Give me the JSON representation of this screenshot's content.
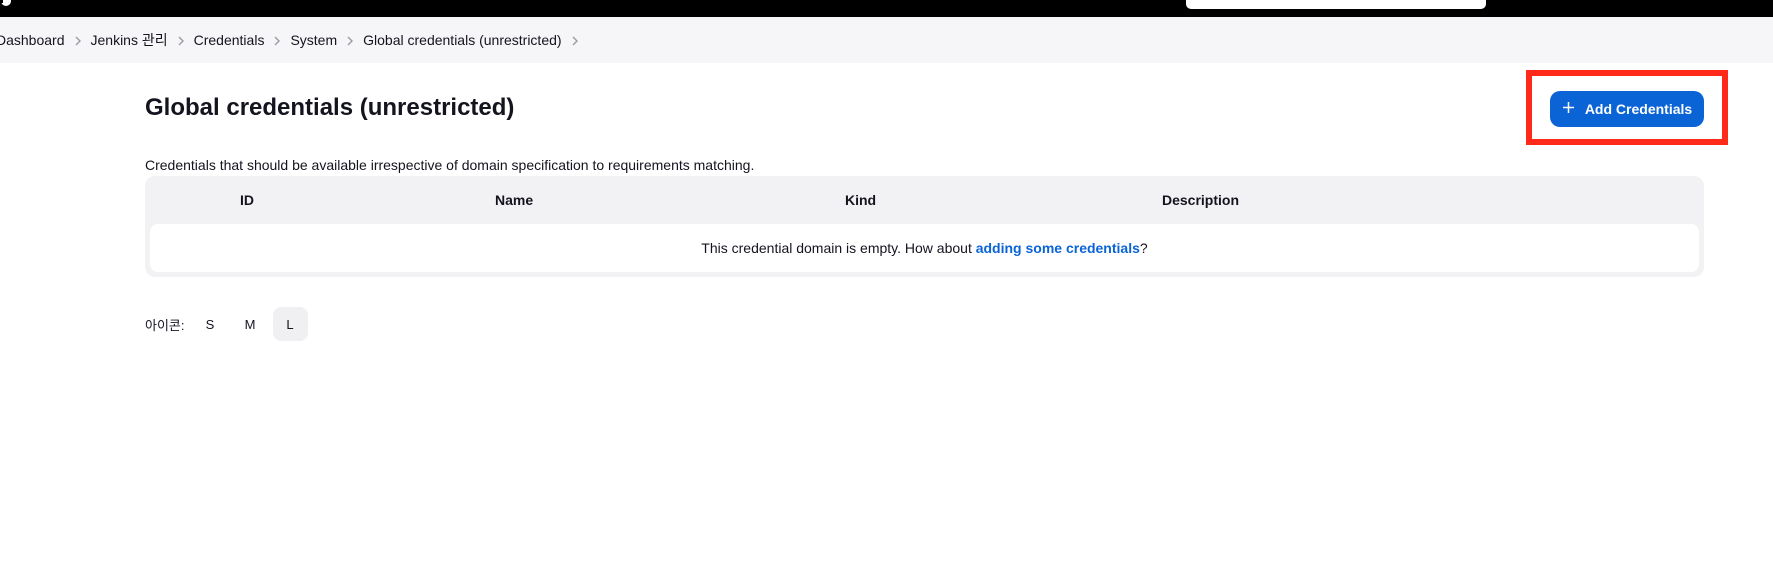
{
  "breadcrumb": {
    "items": [
      "Dashboard",
      "Jenkins 관리",
      "Credentials",
      "System",
      "Global credentials (unrestricted)"
    ]
  },
  "page": {
    "title": "Global credentials (unrestricted)",
    "description": "Credentials that should be available irrespective of domain specification to requirements matching."
  },
  "toolbar": {
    "add_label": "Add Credentials"
  },
  "table": {
    "columns": [
      "ID",
      "Name",
      "Kind",
      "Description"
    ],
    "empty_prefix": "This credential domain is empty. How about ",
    "empty_link": "adding some credentials",
    "empty_suffix": "?"
  },
  "icon_size": {
    "label": "아이콘:",
    "options": [
      "S",
      "M",
      "L"
    ],
    "selected": "L"
  },
  "colors": {
    "accent": "#0a64d6",
    "highlight": "#ff2a1a",
    "topbar": "#000000",
    "breadcrumb_bg": "#f6f6f8"
  },
  "icons": {
    "add": "plus-icon",
    "separator": "chevron-right-icon",
    "logo": "jenkins-logo-icon"
  }
}
